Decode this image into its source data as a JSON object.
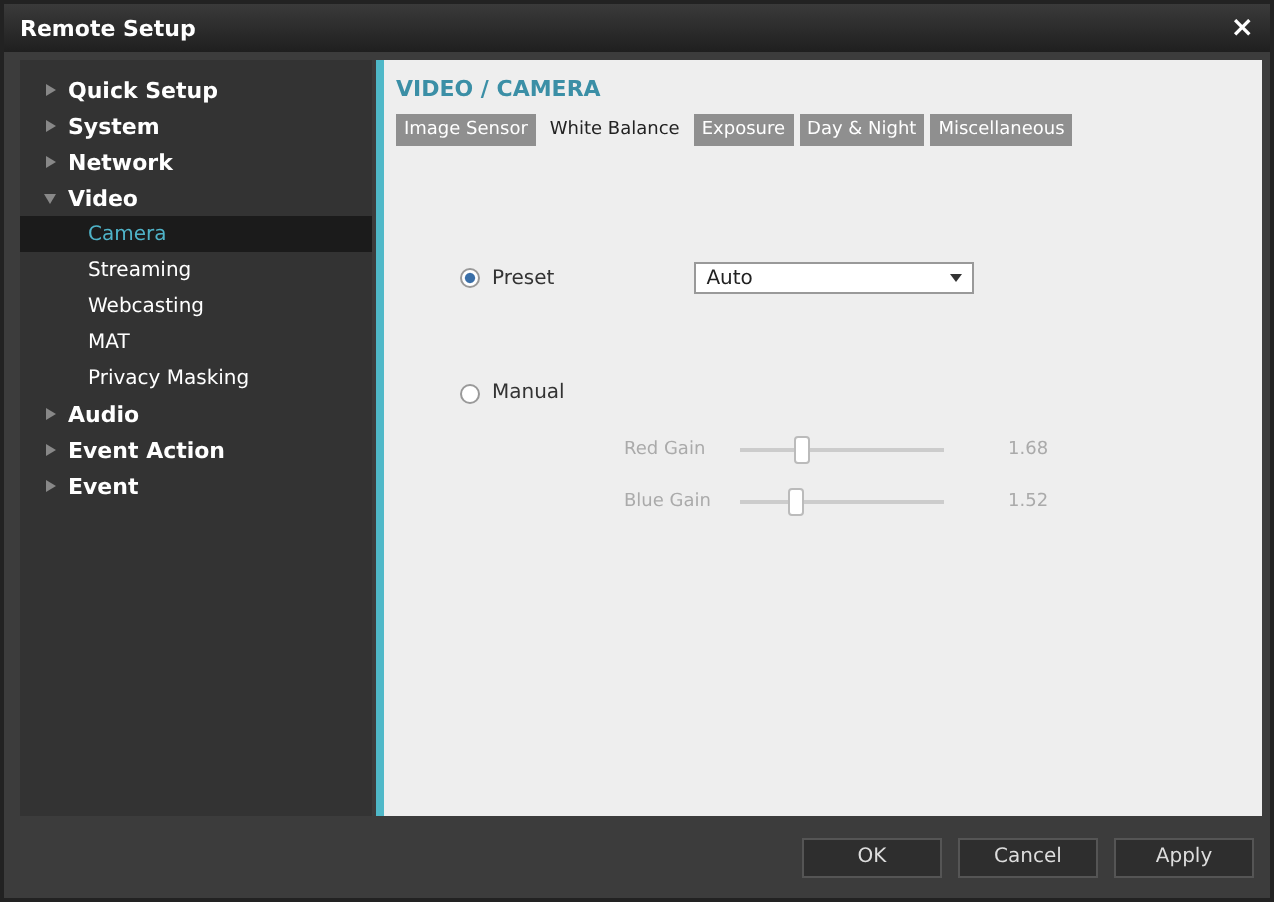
{
  "window": {
    "title": "Remote Setup",
    "close": "×"
  },
  "sidebar": {
    "items": [
      {
        "label": "Quick Setup",
        "expanded": false,
        "selected": false
      },
      {
        "label": "System",
        "expanded": false,
        "selected": false
      },
      {
        "label": "Network",
        "expanded": false,
        "selected": false
      },
      {
        "label": "Video",
        "expanded": true,
        "selected": false,
        "children": [
          {
            "label": "Camera",
            "selected": true
          },
          {
            "label": "Streaming",
            "selected": false
          },
          {
            "label": "Webcasting",
            "selected": false
          },
          {
            "label": "MAT",
            "selected": false
          },
          {
            "label": "Privacy Masking",
            "selected": false
          }
        ]
      },
      {
        "label": "Audio",
        "expanded": false,
        "selected": false
      },
      {
        "label": "Event Action",
        "expanded": false,
        "selected": false
      },
      {
        "label": "Event",
        "expanded": false,
        "selected": false
      }
    ]
  },
  "content": {
    "heading": "VIDEO / CAMERA",
    "tabs": [
      {
        "label": "Image Sensor",
        "selected": false
      },
      {
        "label": "White Balance",
        "selected": true
      },
      {
        "label": "Exposure",
        "selected": false
      },
      {
        "label": "Day & Night",
        "selected": false
      },
      {
        "label": "Miscellaneous",
        "selected": false
      }
    ],
    "preset": {
      "label": "Preset",
      "selected": true,
      "value": "Auto"
    },
    "manual": {
      "label": "Manual",
      "selected": false
    },
    "sliders": [
      {
        "label": "Red Gain",
        "level": 0.3,
        "reading": "1.68",
        "disabled": true
      },
      {
        "label": "Blue Gain",
        "level": 0.27,
        "reading": "1.52",
        "disabled": true
      }
    ]
  },
  "buttons": [
    "OK",
    "Cancel",
    "Apply"
  ]
}
